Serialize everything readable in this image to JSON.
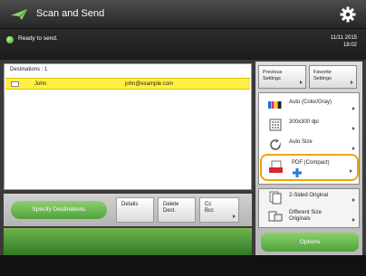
{
  "app": {
    "title": "Scan and Send"
  },
  "status": {
    "text": "Ready to send.",
    "date": "11/11 2015",
    "time": "18:02"
  },
  "destinations": {
    "header": "Destinations : 1",
    "rows": [
      {
        "name": "John",
        "email": "john@example.com",
        "selected": true
      }
    ]
  },
  "buttons": {
    "specify": "Specify Destinations",
    "details": "Details",
    "delete_line1": "Delete",
    "delete_line2": "Dest.",
    "cc_line1": "Cc",
    "cc_line2": "Bcc"
  },
  "top_buttons": {
    "previous_line1": "Previous",
    "previous_line2": "Settings",
    "favorite_line1": "Favorite",
    "favorite_line2": "Settings"
  },
  "settings": {
    "color": "Auto (Color/Gray)",
    "resolution": "300x300 dpi",
    "size": "Auto Size",
    "format": "PDF (Compact)",
    "sided": "2-Sided Original",
    "diff_line1": "Different Size",
    "diff_line2": "Originals"
  },
  "options_label": "Options",
  "colors": {
    "accent_green": "#4ea23c",
    "selection_yellow": "#ffef44",
    "focus_orange": "#f0a600"
  }
}
